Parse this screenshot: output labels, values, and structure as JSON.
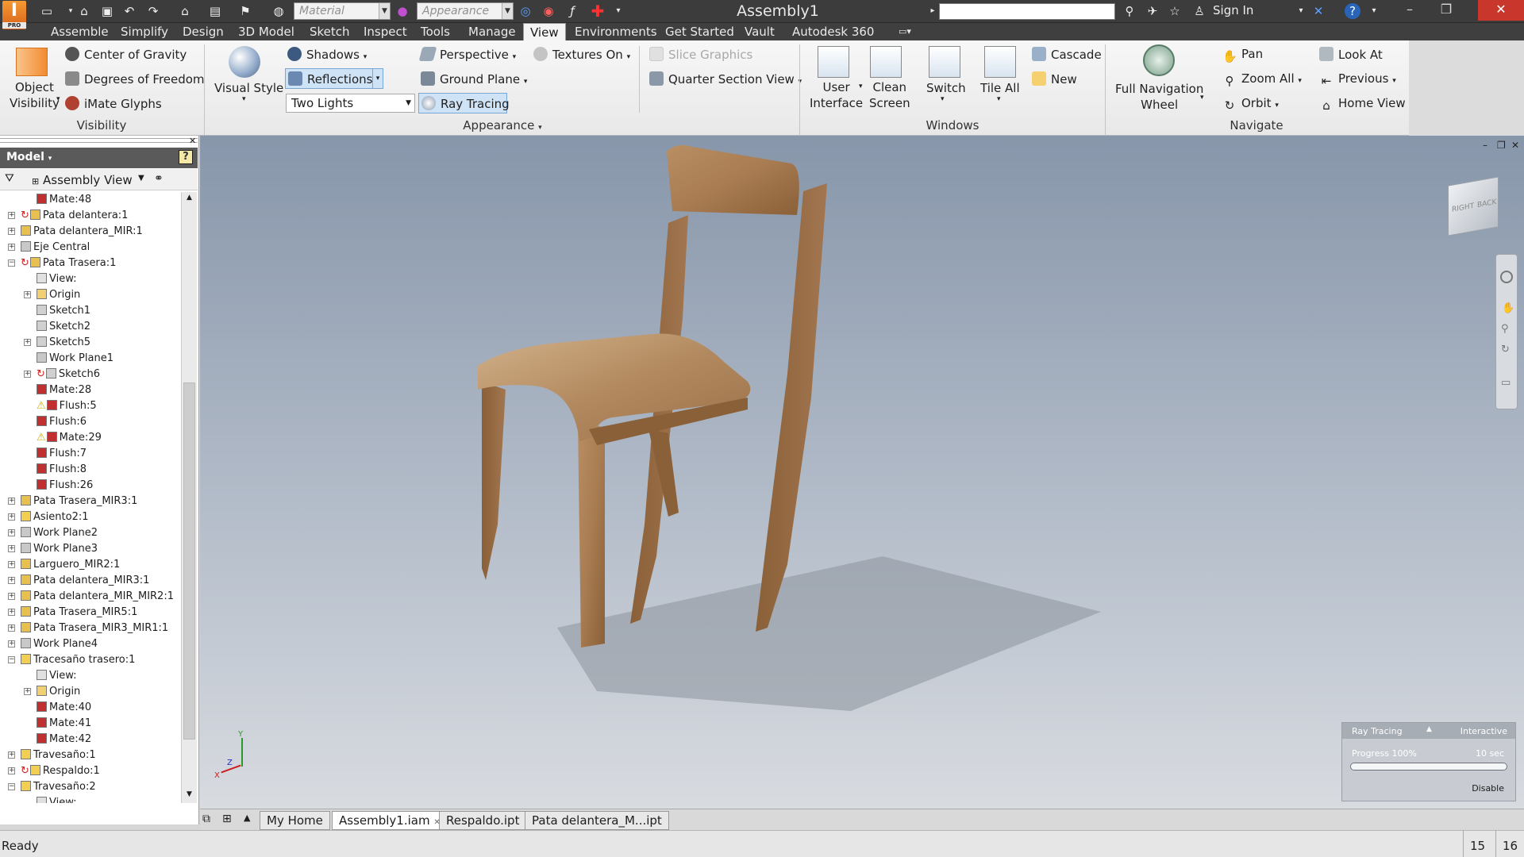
{
  "app": {
    "logo": "I",
    "logo_sub": "PRO",
    "doc_title": "Assembly1"
  },
  "qat": {
    "material_placeholder": "Material",
    "appearance_placeholder": "Appearance"
  },
  "search": {
    "placeholder": ""
  },
  "account": {
    "sign_in": "Sign In"
  },
  "menu_tabs": [
    "Assemble",
    "Simplify",
    "Design",
    "3D Model",
    "Sketch",
    "Inspect",
    "Tools",
    "Manage",
    "View",
    "Environments",
    "Get Started",
    "Vault",
    "Autodesk 360"
  ],
  "ribbon": {
    "visibility": {
      "object_visibility": "Object\nVisibility",
      "center_of_gravity": "Center of Gravity",
      "degrees_of_freedom": "Degrees of Freedom",
      "imate_glyphs": "iMate Glyphs",
      "panel": "Visibility"
    },
    "appearance": {
      "visual_style": "Visual Style",
      "shadows": "Shadows",
      "reflections": "Reflections",
      "lights": "Two Lights",
      "perspective": "Perspective",
      "ground_plane": "Ground Plane",
      "ray_tracing": "Ray Tracing",
      "textures_on": "Textures On",
      "slice_graphics": "Slice Graphics",
      "quarter_section": "Quarter Section View",
      "panel": "Appearance"
    },
    "windows": {
      "user_interface": "User\nInterface",
      "clean_screen": "Clean\nScreen",
      "switch": "Switch",
      "tile_all": "Tile All",
      "cascade": "Cascade",
      "new": "New",
      "panel": "Windows"
    },
    "navigate": {
      "full_nav_wheel": "Full Navigation\nWheel",
      "pan": "Pan",
      "zoom_all": "Zoom All",
      "orbit": "Orbit",
      "look_at": "Look At",
      "previous": "Previous",
      "home_view": "Home View",
      "panel": "Navigate"
    }
  },
  "browser": {
    "title": "Model",
    "view": "Assembly View"
  },
  "tree": [
    {
      "label": "Mate:48",
      "indent": 2,
      "icon": "mate",
      "exp": ""
    },
    {
      "label": "Pata delantera:1",
      "indent": 1,
      "icon": "part",
      "exp": "+",
      "update": true
    },
    {
      "label": "Pata delantera_MIR:1",
      "indent": 1,
      "icon": "part",
      "exp": "+"
    },
    {
      "label": "Eje Central",
      "indent": 1,
      "icon": "plane",
      "exp": "+"
    },
    {
      "label": "Pata Trasera:1",
      "indent": 1,
      "icon": "part",
      "exp": "-",
      "update": true
    },
    {
      "label": "View:",
      "indent": 2,
      "icon": "view",
      "exp": ""
    },
    {
      "label": "Origin",
      "indent": 2,
      "icon": "folder",
      "exp": "+"
    },
    {
      "label": "Sketch1",
      "indent": 2,
      "icon": "sketch",
      "exp": ""
    },
    {
      "label": "Sketch2",
      "indent": 2,
      "icon": "sketch",
      "exp": ""
    },
    {
      "label": "Sketch5",
      "indent": 2,
      "icon": "sketch",
      "exp": "+"
    },
    {
      "label": "Work Plane1",
      "indent": 2,
      "icon": "plane",
      "exp": ""
    },
    {
      "label": "Sketch6",
      "indent": 2,
      "icon": "sketch",
      "exp": "+",
      "update": true
    },
    {
      "label": "Mate:28",
      "indent": 2,
      "icon": "mate",
      "exp": ""
    },
    {
      "label": "Flush:5",
      "indent": 2,
      "icon": "flush",
      "exp": "",
      "warn": true
    },
    {
      "label": "Flush:6",
      "indent": 2,
      "icon": "flush",
      "exp": ""
    },
    {
      "label": "Mate:29",
      "indent": 2,
      "icon": "mate",
      "exp": "",
      "warn": true
    },
    {
      "label": "Flush:7",
      "indent": 2,
      "icon": "flush",
      "exp": ""
    },
    {
      "label": "Flush:8",
      "indent": 2,
      "icon": "flush",
      "exp": ""
    },
    {
      "label": "Flush:26",
      "indent": 2,
      "icon": "flush",
      "exp": ""
    },
    {
      "label": "Pata Trasera_MIR3:1",
      "indent": 1,
      "icon": "part",
      "exp": "+"
    },
    {
      "label": "Asiento2:1",
      "indent": 1,
      "icon": "cube",
      "exp": "+"
    },
    {
      "label": "Work Plane2",
      "indent": 1,
      "icon": "plane",
      "exp": "+"
    },
    {
      "label": "Work Plane3",
      "indent": 1,
      "icon": "plane",
      "exp": "+"
    },
    {
      "label": "Larguero_MIR2:1",
      "indent": 1,
      "icon": "part",
      "exp": "+"
    },
    {
      "label": "Pata delantera_MIR3:1",
      "indent": 1,
      "icon": "part",
      "exp": "+"
    },
    {
      "label": "Pata delantera_MIR_MIR2:1",
      "indent": 1,
      "icon": "part",
      "exp": "+"
    },
    {
      "label": "Pata Trasera_MIR5:1",
      "indent": 1,
      "icon": "part",
      "exp": "+"
    },
    {
      "label": "Pata Trasera_MIR3_MIR1:1",
      "indent": 1,
      "icon": "part",
      "exp": "+"
    },
    {
      "label": "Work Plane4",
      "indent": 1,
      "icon": "plane",
      "exp": "+"
    },
    {
      "label": "Tracesaño trasero:1",
      "indent": 1,
      "icon": "cube",
      "exp": "-"
    },
    {
      "label": "View:",
      "indent": 2,
      "icon": "view",
      "exp": ""
    },
    {
      "label": "Origin",
      "indent": 2,
      "icon": "folder",
      "exp": "+"
    },
    {
      "label": "Mate:40",
      "indent": 2,
      "icon": "mate",
      "exp": ""
    },
    {
      "label": "Mate:41",
      "indent": 2,
      "icon": "mate",
      "exp": ""
    },
    {
      "label": "Mate:42",
      "indent": 2,
      "icon": "mate",
      "exp": ""
    },
    {
      "label": "Travesaño:1",
      "indent": 1,
      "icon": "cube",
      "exp": "+"
    },
    {
      "label": "Respaldo:1",
      "indent": 1,
      "icon": "cube",
      "exp": "+",
      "update": true
    },
    {
      "label": "Travesaño:2",
      "indent": 1,
      "icon": "cube",
      "exp": "-"
    },
    {
      "label": "View:",
      "indent": 2,
      "icon": "view",
      "exp": ""
    }
  ],
  "viewcube": {
    "right": "RIGHT",
    "back": "BACK"
  },
  "ray_tracing_panel": {
    "title": "Ray Tracing",
    "mode": "Interactive",
    "progress_label": "Progress 100%",
    "time": "10 sec",
    "disable": "Disable",
    "progress": 1.0
  },
  "doc_tabs": [
    "My Home",
    "Assembly1.iam",
    "Respaldo.ipt",
    "Pata delantera_M...ipt"
  ],
  "status": {
    "text": "Ready",
    "count1": "15",
    "count2": "16"
  },
  "colors": {
    "wood": "#a97c52",
    "wood_dark": "#7a5532",
    "accent": "#c9372c"
  }
}
